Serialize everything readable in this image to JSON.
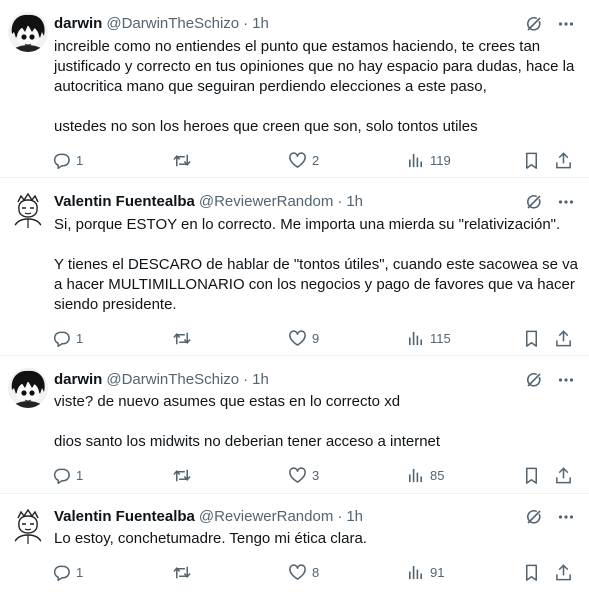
{
  "tweets": [
    {
      "name": "darwin",
      "handle": "@DarwinTheSchizo",
      "separator": "·",
      "time": "1h",
      "paragraphs": [
        "increible como no entiendes el punto que estamos haciendo, te crees tan justificado y correcto en tus opiniones que no hay espacio para dudas, hace la autocritica mano que seguiran perdiendo elecciones a este paso,",
        "ustedes no son los heroes que creen que son, solo tontos utiles"
      ],
      "replies": "1",
      "retweets": "",
      "likes": "2",
      "views": "119"
    },
    {
      "name": "Valentin Fuentealba",
      "handle": "@ReviewerRandom",
      "separator": "·",
      "time": "1h",
      "paragraphs": [
        "Si, porque ESTOY en lo correcto. Me importa una mierda su \"relativización\".",
        "Y tienes el DESCARO de hablar de \"tontos útiles\", cuando este sacowea se va a hacer MULTIMILLONARIO con los negocios y pago de favores que va hacer siendo presidente."
      ],
      "replies": "1",
      "retweets": "",
      "likes": "9",
      "views": "115"
    },
    {
      "name": "darwin",
      "handle": "@DarwinTheSchizo",
      "separator": "·",
      "time": "1h",
      "paragraphs": [
        "viste? de nuevo asumes que estas en lo correcto xd",
        "dios santo los midwits no deberian tener acceso a internet"
      ],
      "replies": "1",
      "retweets": "",
      "likes": "3",
      "views": "85"
    },
    {
      "name": "Valentin Fuentealba",
      "handle": "@ReviewerRandom",
      "separator": "·",
      "time": "1h",
      "paragraphs": [
        "Lo estoy, conchetumadre. Tengo mi ética clara."
      ],
      "replies": "1",
      "retweets": "",
      "likes": "8",
      "views": "91"
    }
  ],
  "icons": {
    "grok": "grok-icon",
    "more": "more-icon",
    "reply": "reply-icon",
    "retweet": "retweet-icon",
    "like": "heart-icon",
    "views": "views-icon",
    "bookmark": "bookmark-icon",
    "share": "share-icon"
  },
  "colors": {
    "text": "#0f1419",
    "muted": "#536471",
    "divider": "#eff3f4"
  }
}
